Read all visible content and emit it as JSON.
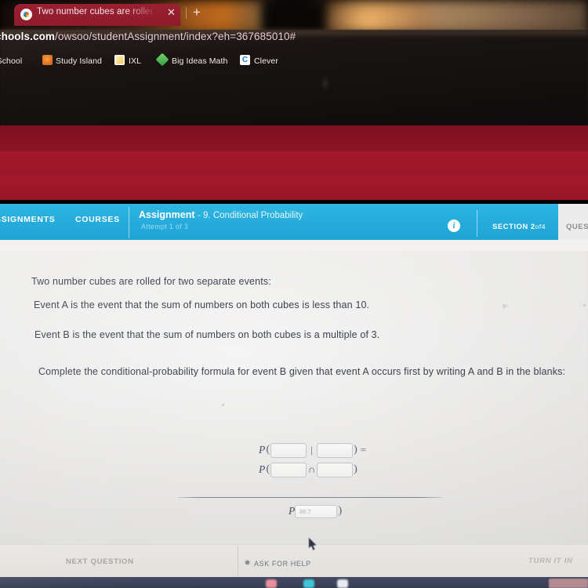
{
  "browser": {
    "back_glyph": "‹",
    "tab": {
      "title": "Two number cubes are rolled fo",
      "favicon_name": "google-favicon",
      "close_glyph": "✕",
      "new_tab_glyph": "+"
    },
    "url": {
      "host": "chools.com",
      "path": "/owsoo/studentAssignment/index?eh=367685010#"
    },
    "bookmarks": [
      {
        "label": "rSchool",
        "icon": "powerschool-icon"
      },
      {
        "label": "Study Island",
        "icon": "study-island-icon"
      },
      {
        "label": "IXL",
        "icon": "ixl-icon"
      },
      {
        "label": "Big Ideas Math",
        "icon": "big-ideas-math-icon"
      },
      {
        "label": "Clever",
        "icon": "clever-icon"
      }
    ]
  },
  "navbar": {
    "assignments_label": "SSIGNMENTS",
    "courses_label": "COURSES",
    "assignment_title": "Assignment",
    "assignment_subtitle": "- 9. Conditional Probability",
    "attempt_text": "Attempt 1 of 3",
    "info_glyph": "i",
    "section_label": "SECTION",
    "section_number": "2",
    "section_of": "of",
    "section_total": "4",
    "question_label": "QUEST"
  },
  "question": {
    "lines": [
      "Two number cubes are rolled for two separate events:",
      "Event A is the event that the sum of numbers on both cubes is less than 10.",
      "Event B is the event that the sum of numbers on both cubes is a multiple of 3.",
      "Complete the conditional-probability formula for event B given that event A occurs first by writing A and B in the blanks:"
    ]
  },
  "formula": {
    "p_symbol": "P",
    "open_paren": "(",
    "close_paren": ")",
    "given_symbol": "|",
    "intersect_symbol": "∩",
    "equals_symbol": "=",
    "numerator_row1": {
      "blank1_value": "",
      "blank2_value": ""
    },
    "numerator_row2": {
      "blank1_value": "",
      "blank2_value": ""
    },
    "denominator": {
      "value": "",
      "placeholder": "36.7"
    }
  },
  "actions": {
    "next_question": "NEXT QUESTION",
    "ask_for_help": "ASK FOR HELP",
    "ask_for_help_icon": "question-circle-icon",
    "turn_it_in": "TURN IT IN"
  },
  "taskbar": {
    "icons": [
      "app-icon-pink",
      "app-icon-cyan",
      "app-icon-white"
    ]
  },
  "colors": {
    "browser_red": "#a3182c",
    "app_blue": "#25aadb",
    "page_bg": "#f1f0ee",
    "taskbar_blue": "#3b4259"
  }
}
